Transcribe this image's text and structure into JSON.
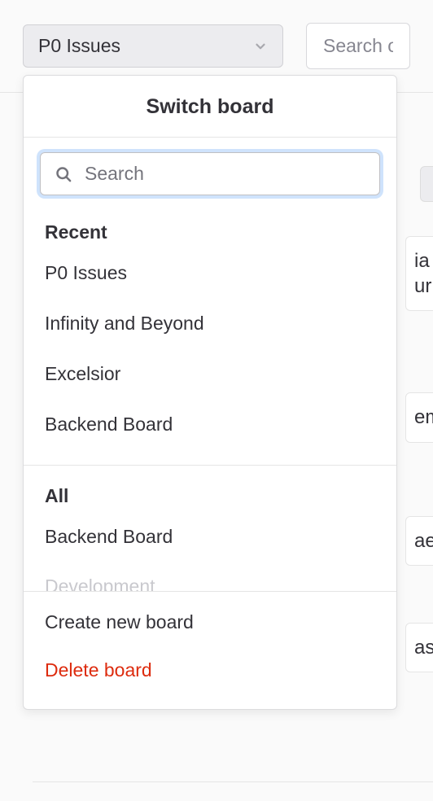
{
  "header": {
    "board_selector_label": "P0 Issues",
    "search_placeholder": "Search or f"
  },
  "dropdown": {
    "title": "Switch board",
    "search_placeholder": "Search",
    "sections": {
      "recent": {
        "heading": "Recent",
        "items": [
          "P0 Issues",
          "Infinity and Beyond",
          "Excelsior",
          "Backend Board"
        ]
      },
      "all": {
        "heading": "All",
        "items": [
          "Backend Board",
          "Development"
        ]
      }
    },
    "footer": {
      "create": "Create new board",
      "delete": "Delete board"
    }
  },
  "background": {
    "fragments": [
      "ia\nur",
      "em",
      "ae",
      "as"
    ]
  }
}
